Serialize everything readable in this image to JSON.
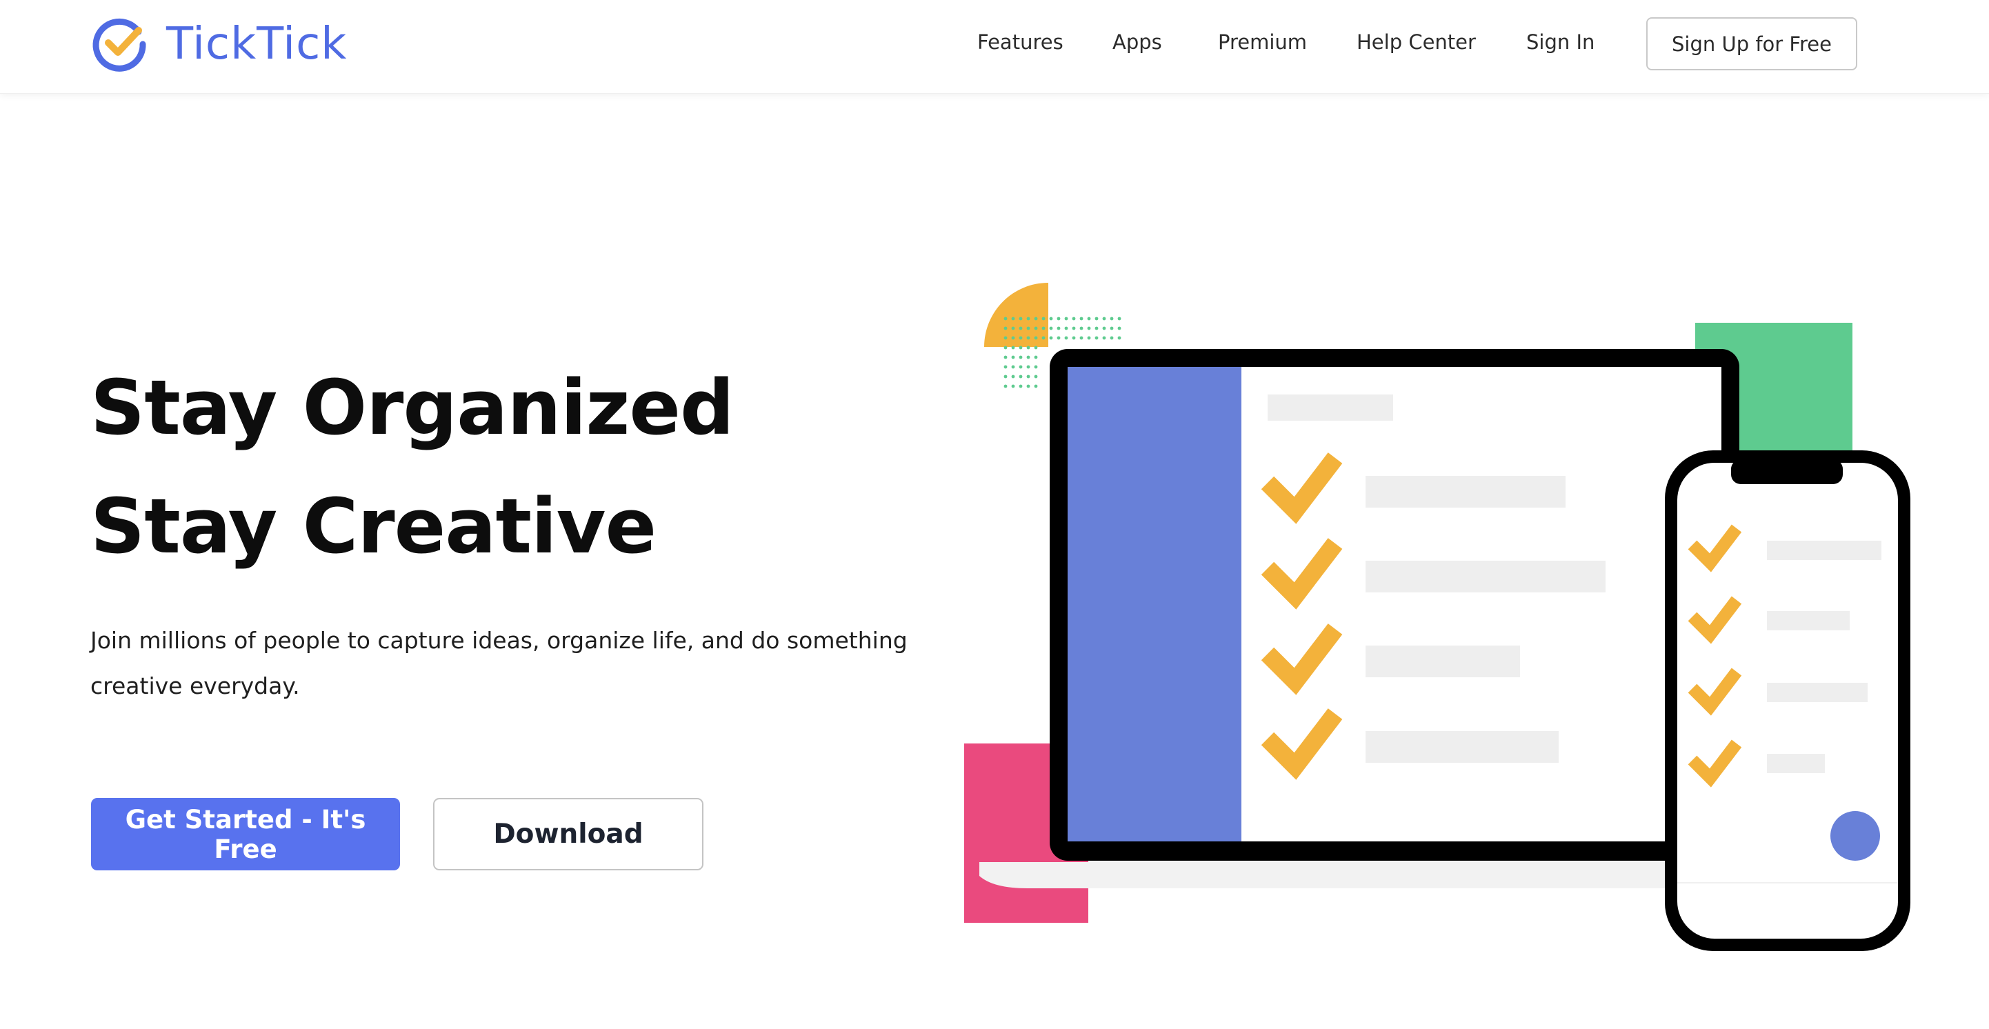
{
  "brand": {
    "name": "TickTick",
    "logo_icon": "ticktick-check-circle-icon",
    "color_primary": "#4f6be3",
    "color_check": "#f3b23b"
  },
  "nav": {
    "links": [
      "Features",
      "Apps",
      "Premium",
      "Help Center",
      "Sign In"
    ],
    "signup_label": "Sign Up for Free"
  },
  "hero": {
    "title_line1": "Stay Organized",
    "title_line2": "Stay Creative",
    "subtitle_line1": "Join millions of people to capture ideas, organize life, and do something",
    "subtitle_line2": "creative everyday.",
    "primary_cta": "Get Started - It's Free",
    "secondary_cta": "Download"
  },
  "illustration": {
    "colors": {
      "sidebar": "#6880d8",
      "check": "#f3b23b",
      "green": "#5ecb8f",
      "pink": "#ea4a7e",
      "placeholder": "#eeeeee",
      "fab": "#6880d8"
    }
  }
}
